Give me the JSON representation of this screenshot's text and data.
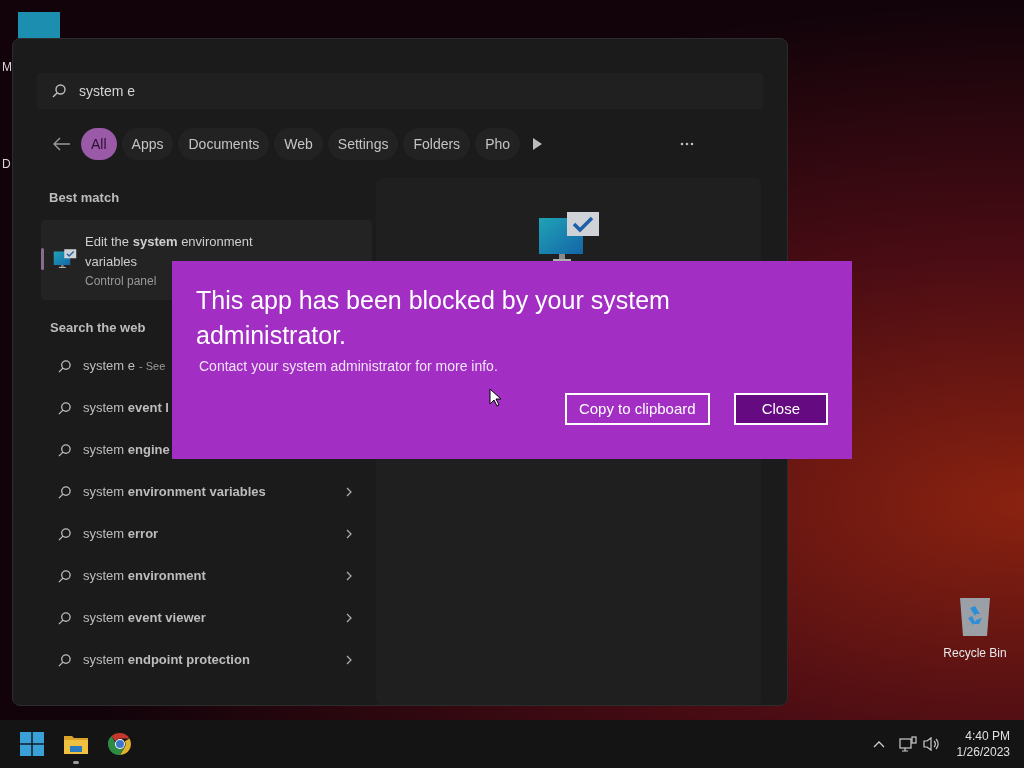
{
  "desktop": {
    "icons": [
      {
        "label": "M"
      },
      {
        "label": "D"
      }
    ],
    "recycle_bin": {
      "label": "Recycle Bin"
    }
  },
  "start_menu": {
    "search": {
      "value": "system e"
    },
    "filters": [
      {
        "label": "All",
        "selected": true
      },
      {
        "label": "Apps",
        "selected": false
      },
      {
        "label": "Documents",
        "selected": false
      },
      {
        "label": "Web",
        "selected": false
      },
      {
        "label": "Settings",
        "selected": false
      },
      {
        "label": "Folders",
        "selected": false
      },
      {
        "label": "Pho",
        "selected": false
      }
    ],
    "best_match": {
      "heading": "Best match",
      "title": "Edit the **system** environment variables",
      "subtitle": "Control panel"
    },
    "web": {
      "heading": "Search the web",
      "items": [
        {
          "text": "system e",
          "suffix": "- See"
        },
        {
          "text": "system **event l**"
        },
        {
          "text": "system **engine**"
        },
        {
          "text": "system **environment variables**",
          "chevron": true
        },
        {
          "text": "system **error**",
          "chevron": true
        },
        {
          "text": "system **environment**",
          "chevron": true
        },
        {
          "text": "system **event viewer**",
          "chevron": true
        },
        {
          "text": "system **endpoint protection**",
          "chevron": true
        }
      ]
    }
  },
  "dialog": {
    "title": "This app has been blocked by your system administrator.",
    "message": "Contact your system administrator for more info.",
    "buttons": [
      {
        "label": "Copy to clipboard",
        "kind": "secondary"
      },
      {
        "label": "Close",
        "kind": "primary"
      }
    ]
  },
  "taskbar": {
    "apps": [
      {
        "kind": "start",
        "running": false
      },
      {
        "kind": "explorer",
        "running": true
      },
      {
        "kind": "browser",
        "running": false
      }
    ],
    "time": "4:40 PM",
    "date": "1/26/2023"
  }
}
